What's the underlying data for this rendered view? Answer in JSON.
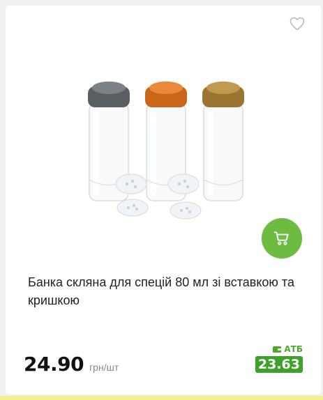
{
  "product": {
    "title": "Банка скляна для спецій 80 мл зі вставкою та кришкою",
    "price": "24.90",
    "unit": "грн/шт"
  },
  "promo": {
    "store": "АТБ",
    "price": "23.63"
  },
  "icons": {
    "favorite": "heart-outline-icon",
    "cart": "shopping-cart-icon",
    "wallet": "wallet-icon"
  },
  "colors": {
    "accent_green": "#6dbb40",
    "promo_green": "#3fa02a"
  }
}
